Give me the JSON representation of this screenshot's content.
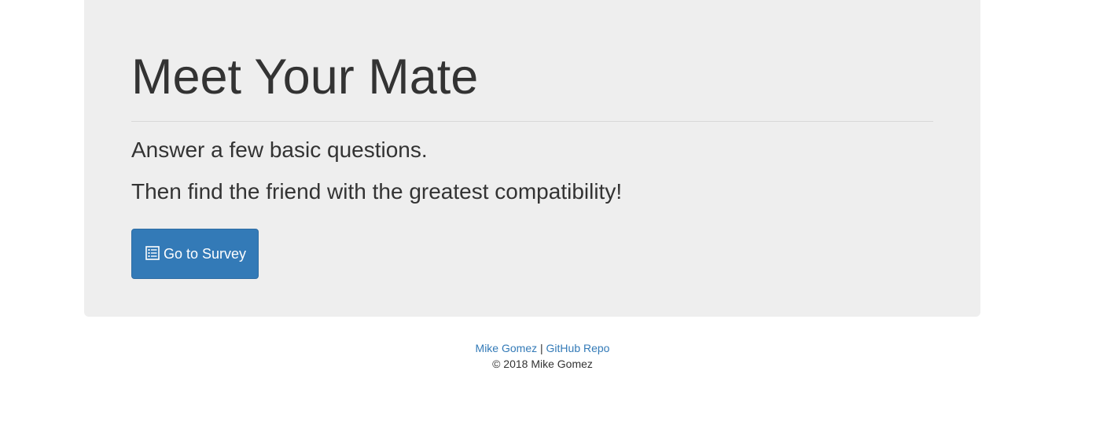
{
  "jumbotron": {
    "title": "Meet Your Mate",
    "lead_lines": [
      "Answer a few basic questions.",
      "Then find the friend with the greatest compatibility!"
    ],
    "survey_button": {
      "icon": "list-alt-icon",
      "label": "Go to Survey"
    }
  },
  "footer": {
    "author_link": "Mike Gomez",
    "separator": "|",
    "repo_link": "GitHub Repo",
    "copyright": "© 2018 Mike Gomez"
  },
  "colors": {
    "jumbotron_bg": "#eeeeee",
    "primary": "#337ab7",
    "text": "#333333"
  }
}
